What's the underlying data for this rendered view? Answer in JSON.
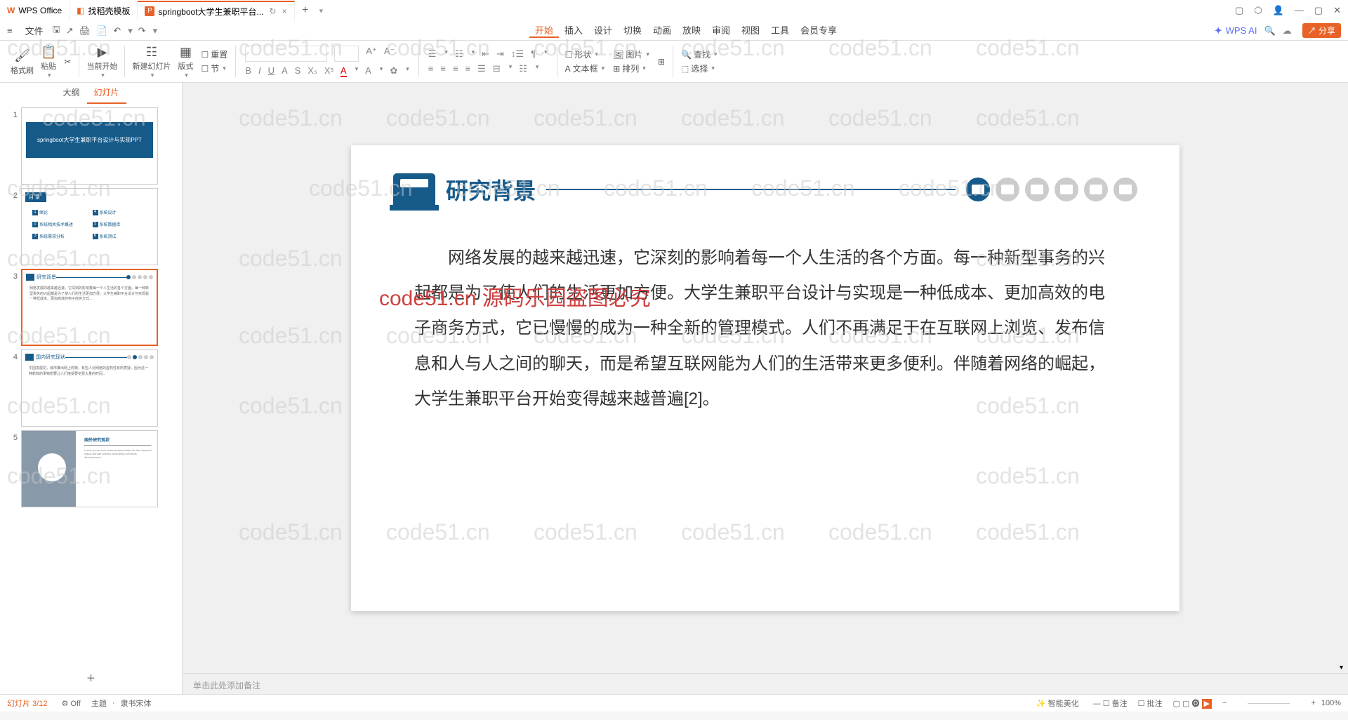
{
  "tabs": {
    "wps_office": "WPS Office",
    "stencil": "找稻壳模板",
    "current": "springboot大学生兼职平台...",
    "close": "×"
  },
  "syscontrols": {
    "window1": "▢",
    "box": "⬡",
    "user": "👤",
    "min": "—",
    "max": "▢",
    "close": "✕"
  },
  "menubar": {
    "hamburger": "≡",
    "file": "文件",
    "items": [
      "开始",
      "插入",
      "设计",
      "切换",
      "动画",
      "放映",
      "审阅",
      "视图",
      "工具",
      "会员专享"
    ],
    "ai": "WPS AI",
    "search": "🔍",
    "cloud": "☁",
    "share": "分享"
  },
  "quickbar": {
    "save": "🖫",
    "export": "↗",
    "print": "🖨",
    "preview": "📄",
    "undo": "↶",
    "redo": "↷"
  },
  "ribbon": {
    "brush": "格式刷",
    "paste": "粘贴",
    "cut": "✂",
    "current_start": "当前开始",
    "new_slide": "新建幻灯片",
    "layout": "版式",
    "section": "节",
    "reset": "重置",
    "cb": "▢ 重置",
    "bold": "B",
    "italic": "I",
    "underline": "U",
    "strike": "A",
    "highlight": "ˢ",
    "sub": "Xₛ",
    "sup": "Xˢ",
    "color": "A",
    "bg": "A",
    "clear": "A✿",
    "align_l": "≡",
    "center": "≡",
    "align_r": "≡",
    "just": "≡",
    "line": "☰",
    "indent_l": "⇤",
    "indent_r": "⇥",
    "dir": "¶",
    "shape": "形状",
    "pic": "图片",
    "textbox": "文本框",
    "arrange": "排列",
    "snap": "⊞",
    "find": "查找",
    "select": "选择"
  },
  "panel": {
    "outline": "大纲",
    "slides": "幻灯片"
  },
  "thumbs": {
    "t1": "springboot大学生兼职平台设计与实现PPT",
    "t2_head": "目 录",
    "t2": [
      [
        "绪论",
        "系统设计"
      ],
      [
        "系统相关技术概述",
        "系统数据库"
      ],
      [
        "系统需求分析",
        "系统测试"
      ]
    ],
    "t3_title": "研究背景",
    "t3_body": "网络发展的越来越迅速，它深刻的影响着每一个人生活的各个方面。每一种新型事务的兴起都是为了使人们的生活更加方便。大学生兼职平台设计与实现是一种低成本、更加高效的电子商务方式...",
    "t4_title": "国内研究现状",
    "t4_body": "中国发展初，城市推出网上购物，有些人对网络的虚构性有所质疑，因为这一种新鲜的事物想要让人们接受要花费大量的时间...",
    "t5_title": "国外研究现状"
  },
  "slide": {
    "title": "研究背景",
    "body": "网络发展的越来越迅速，它深刻的影响着每一个人生活的各个方面。每一种新型事务的兴起都是为了使人们的生活更加方便。大学生兼职平台设计与实现是一种低成本、更加高效的电子商务方式，它已慢慢的成为一种全新的管理模式。人们不再满足于在互联网上浏览、发布信息和人与人之间的聊天，而是希望互联网能为人们的生活带来更多便利。伴随着网络的崛起，大学生兼职平台开始变得越来越普遍[2]。"
  },
  "watermark": {
    "text": "code51.cn",
    "red": "code51.cn 源码乐园盗图必究"
  },
  "notes": "单击此处添加备注",
  "addslide": "+",
  "status": {
    "left": "幻灯片 3/12",
    "off": "Off",
    "theme": "主题",
    "font": "隶书宋体",
    "beautify": "智能美化",
    "note": "备注",
    "comment": "批注",
    "view": "▢ ▢ ▢ ▣",
    "zoom": "100%"
  }
}
